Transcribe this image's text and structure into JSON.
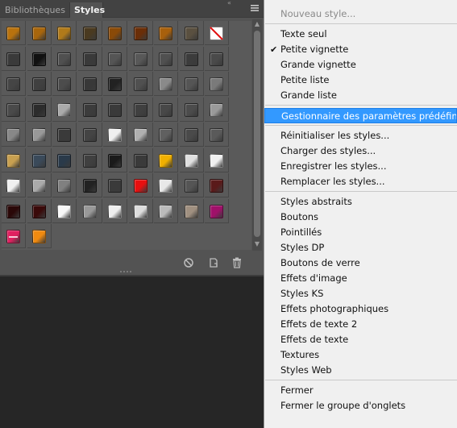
{
  "panel": {
    "tabs": [
      {
        "label": "Bibliothèques",
        "active": false
      },
      {
        "label": "Styles",
        "active": true
      }
    ],
    "collapse_glyph": "«",
    "menu_icon": "hamburger-icon",
    "swatches": [
      [
        "#b8720e",
        "#a8660c",
        "#b07a1a",
        "#4a3a20",
        "#8a4a08",
        "#6a2e08",
        "#a8600c",
        "#5a5040",
        "#ffffff"
      ],
      [
        "#3a3a3a",
        "#111111",
        "#505050",
        "#3a3a3a",
        "#555555",
        "#585858",
        "#505050",
        "#3c3c3c",
        "#4a4a4a"
      ],
      [
        "#454545",
        "#404040",
        "#4c4c4c",
        "#383838",
        "#222222",
        "#505050",
        "#8a8a8a",
        "#555555",
        "#7a7a7a"
      ],
      [
        "#4a4a4a",
        "#2c2c2c",
        "#aaaaaa",
        "#3c3c3c",
        "#3a3a3a",
        "#404040",
        "#484848",
        "#4c4c4c",
        "#9a9a9a"
      ],
      [
        "#888888",
        "#999999",
        "#3a3a3a",
        "#444444",
        "#f0f0f0",
        "#b0b0b0",
        "#606060",
        "#4a4a4a",
        "#5a5a5a"
      ],
      [
        "#c8a050",
        "#3a4a5a",
        "#2a3a4a",
        "#404040",
        "#1a1a1a",
        "#3a3a3a",
        "#f0b000",
        "#e0e0e0",
        "#f0f0f0"
      ],
      [
        "#f0f0f0",
        "#aaaaaa",
        "#808080",
        "#222222",
        "#3a3a3a",
        "#e81010",
        "#e8e8e8",
        "#555555",
        "#5a1a1a"
      ],
      [
        "#2a0808",
        "#3a0a0a",
        "#f8f8f8",
        "#999999",
        "#eeeeee",
        "#dddddd",
        "#bbbbbb",
        "#a09080",
        "#a0106a"
      ],
      [
        "#e02060",
        "#f08a10"
      ]
    ],
    "footer_icons": [
      "no-style-icon",
      "new-style-icon",
      "trash-icon"
    ]
  },
  "menu": {
    "items": [
      {
        "label": "Nouveau style...",
        "disabled": true
      },
      {
        "sep": true
      },
      {
        "label": "Texte seul"
      },
      {
        "label": "Petite vignette",
        "checked": true
      },
      {
        "label": "Grande vignette"
      },
      {
        "label": "Petite liste"
      },
      {
        "label": "Grande liste"
      },
      {
        "sep": true
      },
      {
        "label": "Gestionnaire des paramètres prédéfinis...",
        "highlighted": true
      },
      {
        "sep": true
      },
      {
        "label": "Réinitialiser les styles..."
      },
      {
        "label": "Charger des styles..."
      },
      {
        "label": "Enregistrer les styles..."
      },
      {
        "label": "Remplacer les styles..."
      },
      {
        "sep": true
      },
      {
        "label": "Styles abstraits"
      },
      {
        "label": "Boutons"
      },
      {
        "label": "Pointillés"
      },
      {
        "label": "Styles DP"
      },
      {
        "label": "Boutons de verre"
      },
      {
        "label": "Effets d'image"
      },
      {
        "label": "Styles KS"
      },
      {
        "label": "Effets photographiques"
      },
      {
        "label": "Effets de texte 2"
      },
      {
        "label": "Effets de texte"
      },
      {
        "label": "Textures"
      },
      {
        "label": "Styles Web"
      },
      {
        "sep": true
      },
      {
        "label": "Fermer"
      },
      {
        "label": "Fermer le groupe d'onglets"
      }
    ],
    "check_glyph": "✔"
  }
}
